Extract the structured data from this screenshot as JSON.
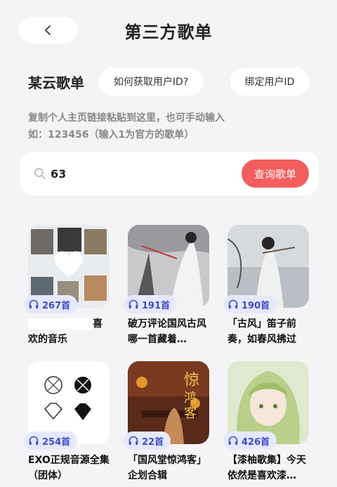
{
  "header": {
    "title": "第三方歌单"
  },
  "section": {
    "title": "某云歌单",
    "how_label": "如何获取用户ID?",
    "bind_label": "绑定用户ID"
  },
  "hint": {
    "line1": "复制个人主页链接粘贴到这里，也可手动输入",
    "line2": "如：123456（输入1为官方的歌单）"
  },
  "search": {
    "value": "63",
    "button_label": "查询歌单"
  },
  "playlists": [
    {
      "count": "267首",
      "title": "喜欢的音乐",
      "title_prefix_redacted": true
    },
    {
      "count": "191首",
      "title": "破万评论国风古风 哪一首藏着…"
    },
    {
      "count": "190首",
      "title": "「古风」笛子前奏，如春风拂过"
    },
    {
      "count": "254首",
      "title": "EXO正规音源全集（团体）"
    },
    {
      "count": "22首",
      "title": "「国风堂惊鸿客」企划合辑"
    },
    {
      "count": "426首",
      "title": "【漆柚歌集】今天依然是喜欢漆…"
    }
  ],
  "colors": {
    "accent": "#f25d5d",
    "badge_bg": "#e6e8ff",
    "badge_text": "#3b4cc9",
    "background": "#f4f4f6"
  }
}
